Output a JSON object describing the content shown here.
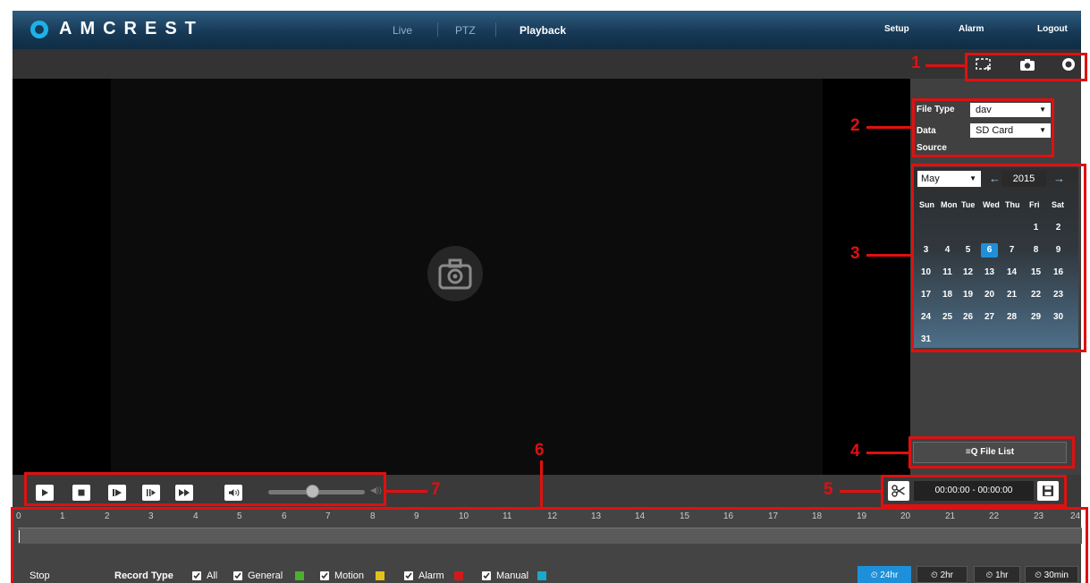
{
  "brand": "AMCREST",
  "nav": {
    "live": "Live",
    "ptz": "PTZ",
    "playback": "Playback"
  },
  "top_links": {
    "setup": "Setup",
    "alarm": "Alarm",
    "logout": "Logout"
  },
  "filters": {
    "file_type_label": "File Type",
    "file_type_value": "dav",
    "data_label": "Data",
    "source_label": "Source",
    "data_source_value": "SD Card"
  },
  "calendar": {
    "month": "May",
    "year": "2015",
    "weekdays": [
      "Sun",
      "Mon",
      "Tue",
      "Wed",
      "Thu",
      "Fri",
      "Sat"
    ],
    "weeks": [
      [
        "",
        "",
        "",
        "",
        "",
        "1",
        "2"
      ],
      [
        "3",
        "4",
        "5",
        "6",
        "7",
        "8",
        "9"
      ],
      [
        "10",
        "11",
        "12",
        "13",
        "14",
        "15",
        "16"
      ],
      [
        "17",
        "18",
        "19",
        "20",
        "21",
        "22",
        "23"
      ],
      [
        "24",
        "25",
        "26",
        "27",
        "28",
        "29",
        "30"
      ],
      [
        "31",
        "",
        "",
        "",
        "",
        "",
        ""
      ]
    ],
    "selected_day": "6"
  },
  "file_list_label": "File List",
  "time_range": "00:00:00 - 00:00:00",
  "volume_level": 0.45,
  "timeline": {
    "hours": [
      "0",
      "1",
      "2",
      "3",
      "4",
      "5",
      "6",
      "7",
      "8",
      "9",
      "10",
      "11",
      "12",
      "13",
      "14",
      "15",
      "16",
      "17",
      "18",
      "19",
      "20",
      "21",
      "22",
      "23",
      "24"
    ]
  },
  "status": "Stop",
  "record_type": {
    "label": "Record Type",
    "items": [
      {
        "label": "All",
        "color": ""
      },
      {
        "label": "General",
        "color": "#4caf2e"
      },
      {
        "label": "Motion",
        "color": "#e3c21a"
      },
      {
        "label": "Alarm",
        "color": "#d11b1b"
      },
      {
        "label": "Manual",
        "color": "#19a9c9"
      }
    ]
  },
  "ranges": [
    "24hr",
    "2hr",
    "1hr",
    "30min"
  ],
  "active_range": "24hr",
  "annotations": [
    "1",
    "2",
    "3",
    "4",
    "5",
    "6",
    "7"
  ],
  "colors": {
    "accent": "#1e90d9",
    "annotation": "#e01010",
    "header": "#173a56"
  }
}
